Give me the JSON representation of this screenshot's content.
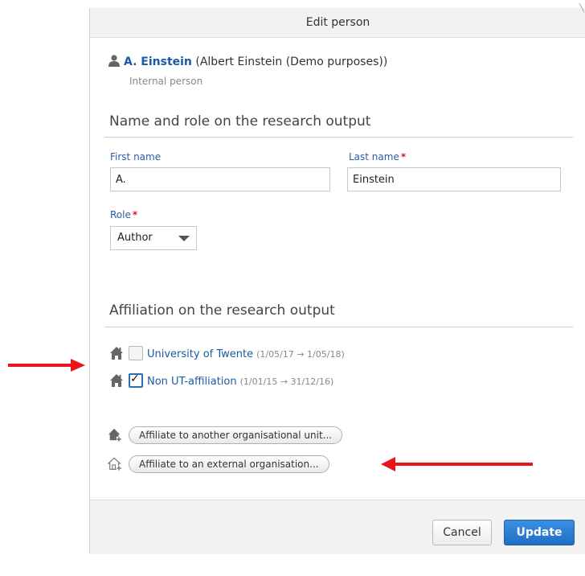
{
  "dialog": {
    "title": "Edit person"
  },
  "person": {
    "name": "A. Einstein",
    "full_name": "(Albert Einstein (Demo purposes))",
    "type": "Internal person",
    "icon": "person-icon"
  },
  "name_role_section": {
    "title": "Name and role on the research output",
    "first_name_label": "First name",
    "first_name_value": "A.",
    "last_name_label": "Last name",
    "last_name_value": "Einstein",
    "required_marker": "*",
    "role_label": "Role",
    "role_value": "Author"
  },
  "affiliation_section": {
    "title": "Affiliation on the research output",
    "items": [
      {
        "name": "University of Twente",
        "dates": "(1/05/17 → 1/05/18)",
        "checked": false,
        "icon": "house-icon"
      },
      {
        "name": "Non UT-affiliation",
        "dates": "(1/01/15 → 31/12/16)",
        "checked": true,
        "icon": "house-icon"
      }
    ],
    "add_internal_label": "Affiliate to another organisational unit...",
    "add_external_label": "Affiliate to an external organisation...",
    "add_internal_icon": "house-add-icon",
    "add_external_icon": "external-house-add-icon"
  },
  "footer": {
    "cancel_label": "Cancel",
    "update_label": "Update"
  },
  "colors": {
    "link_blue": "#1a5aa6",
    "primary_button": "#2a7bd3",
    "required_red": "#cc2222",
    "annotation_arrow": "#e8151b"
  }
}
